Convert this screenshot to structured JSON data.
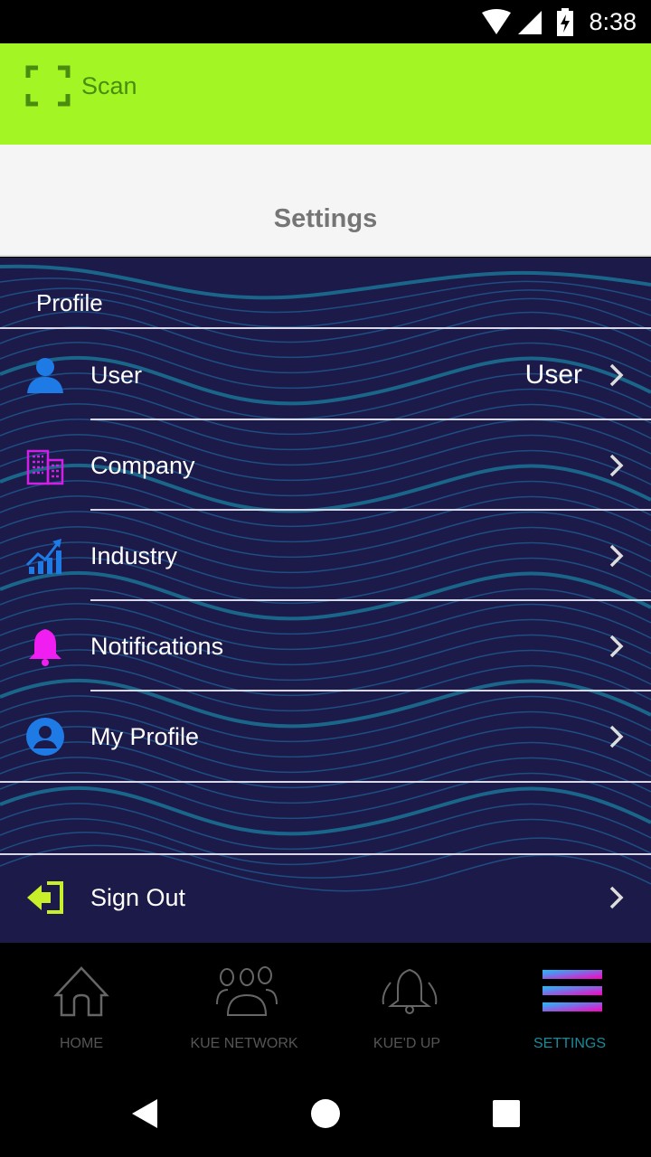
{
  "status_bar": {
    "time": "8:38"
  },
  "app_bar": {
    "scan_label": "Scan",
    "icon": "scan-frame-icon"
  },
  "page_title": "Settings",
  "profile_section": {
    "label": "Profile",
    "items": [
      {
        "label": "User",
        "value": "User",
        "icon": "user-icon",
        "color": "#1e7be6"
      },
      {
        "label": "Company",
        "value": "",
        "icon": "building-icon",
        "color": "#d21ee6"
      },
      {
        "label": "Industry",
        "value": "",
        "icon": "chart-growth-icon",
        "color": "#1e7be6"
      },
      {
        "label": "Notifications",
        "value": "",
        "icon": "bell-icon",
        "color": "#f01ef0"
      },
      {
        "label": "My Profile",
        "value": "",
        "icon": "account-circle-icon",
        "color": "#1e7be6"
      }
    ]
  },
  "sign_out": {
    "label": "Sign Out",
    "icon": "sign-out-icon",
    "color": "#c8f02a"
  },
  "bottom_nav": [
    {
      "label": "HOME",
      "icon": "home-icon"
    },
    {
      "label": "KUE NETWORK",
      "icon": "group-icon"
    },
    {
      "label": "KUE'D UP",
      "icon": "bell-ringing-icon"
    },
    {
      "label": "SETTINGS",
      "icon": "menu-gradient-icon",
      "active": true
    }
  ],
  "colors": {
    "accent": "#a4f524",
    "active_tab": "#1a8a9a",
    "background": "#1c1a48"
  }
}
